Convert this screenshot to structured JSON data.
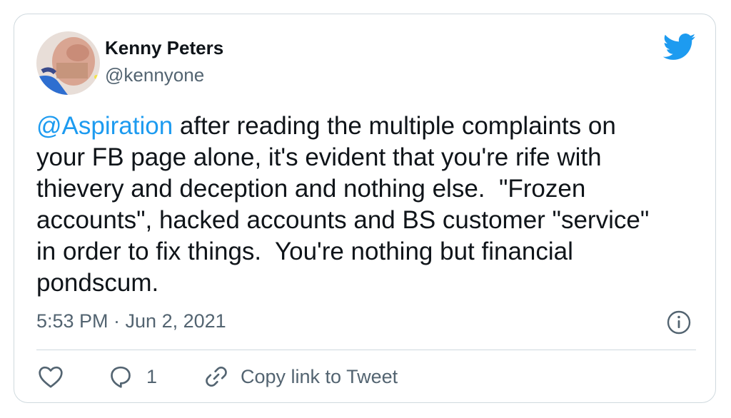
{
  "author": {
    "name": "Kenny Peters",
    "handle": "@kennyone"
  },
  "tweet": {
    "mention": "@Aspiration",
    "text": " after reading the multiple complaints on\nyour FB page alone, it's evident that you're rife with\nthievery and deception and nothing else.  \"Frozen\naccounts\", hacked accounts and BS customer \"service\"\nin order to fix things.  You're nothing but financial\npondscum.",
    "timestamp": "5:53 PM · Jun 2, 2021"
  },
  "actions": {
    "reply_count": "1",
    "copy_link_label": "Copy link to Tweet"
  },
  "icons": {
    "brand": "twitter-bird-icon",
    "info": "info-icon",
    "like": "heart-icon",
    "reply": "speech-bubble-icon",
    "copy": "link-icon"
  },
  "colors": {
    "accent": "#1d9bf0",
    "secondary_text": "#536471",
    "primary_text": "#0f1419",
    "border": "#cfd9de"
  }
}
